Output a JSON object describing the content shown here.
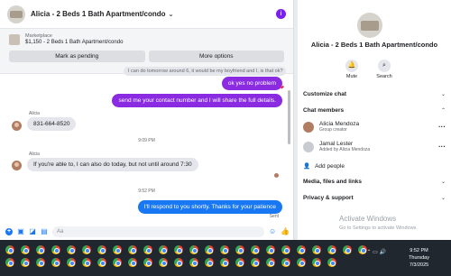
{
  "chat": {
    "title": "Alicia - 2 Beds 1 Bath Apartment/condo",
    "listing": {
      "source": "Marketplace",
      "price_line": "$1,150 - 2 Beds 1 Bath Apartment/condo",
      "btn_pending": "Mark as pending",
      "btn_more": "More options"
    },
    "messages": {
      "quote": "I can do tomorrow around 6, it would be my boyfriend and I, is that ok?",
      "out1": "ok yes no problem",
      "out2": "send me your contact number and I will share the full details.",
      "sender1": "Alicia",
      "in1": "831-664-8520",
      "time1": "9:09 PM",
      "sender2": "Alicia",
      "in2": "If you're able to, I can also do today, but not until around 7:30",
      "time2": "9:52 PM",
      "out3": "I'll respond to you shortly. Thanks for your patience",
      "status": "Sent"
    },
    "composer_placeholder": "Aa"
  },
  "info": {
    "title": "Alicia - 2 Beds 1 Bath Apartment/condo",
    "mute": "Mute",
    "search": "Search",
    "customize": "Customize chat",
    "members_header": "Chat members",
    "members": [
      {
        "name": "Alicia Mendoza",
        "sub": "Group creator"
      },
      {
        "name": "Jamal Lester",
        "sub": "Added by Alicia Mendoza"
      }
    ],
    "add_people": "Add people",
    "media": "Media, files and links",
    "privacy": "Privacy & support"
  },
  "watermark": {
    "title": "Activate Windows",
    "sub": "Go to Settings to activate Windows."
  },
  "taskbar": {
    "time": "9:52 PM",
    "day": "Thursday",
    "date": "7/3/2025"
  }
}
